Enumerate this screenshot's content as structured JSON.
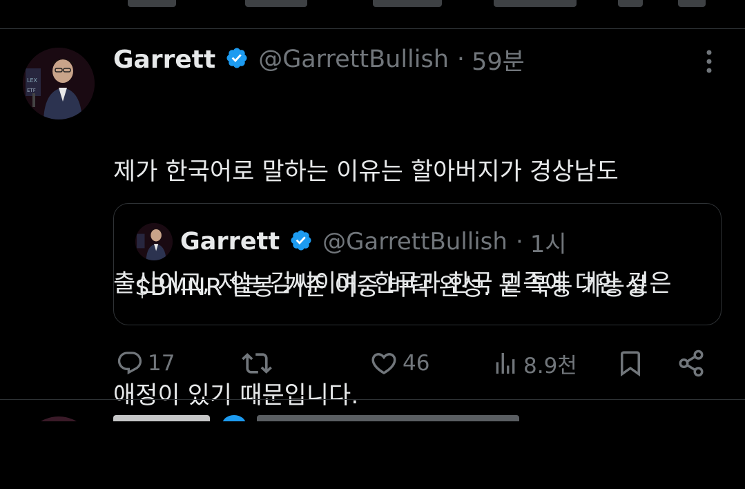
{
  "tweet": {
    "author_name": "Garrett",
    "handle": "@GarrettBullish",
    "separator": "·",
    "time": "59분",
    "text_lines": [
      "제가 한국어로 말하는 이유는 할아버지가 경상남도",
      "출신이고, 저는 김씨이며, 한국과 한국 민족에 대한 깊은",
      "애정이 있기 때문입니다."
    ],
    "quote": {
      "author_name": "Garrett",
      "handle": "@GarrettBullish",
      "separator": "·",
      "time": "1시",
      "text": "$BMNR 일봉 기준 이중 바닥 완성. 곧 폭등 가능성"
    },
    "actions": {
      "replies": "17",
      "retweets": "",
      "likes": "46",
      "views": "8.9천"
    }
  },
  "icons": {
    "verified": "verified-badge-icon",
    "more": "more-vertical-icon",
    "reply": "reply-icon",
    "retweet": "retweet-icon",
    "like": "heart-icon",
    "views": "views-icon",
    "bookmark": "bookmark-icon",
    "share": "share-icon"
  },
  "colors": {
    "background": "#000000",
    "text": "#e7e9ea",
    "secondary": "#71767b",
    "verified": "#1d9bf0",
    "border": "#2f3336"
  }
}
